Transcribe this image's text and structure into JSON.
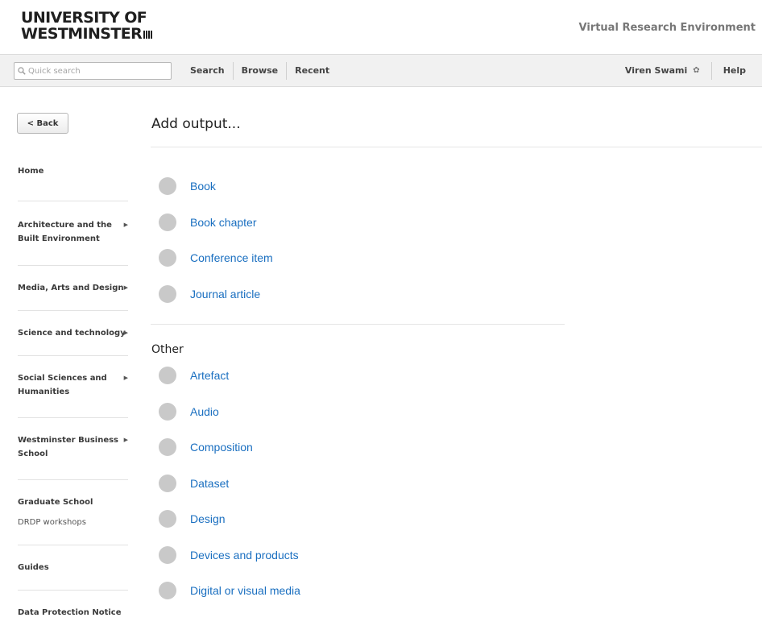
{
  "header": {
    "logo_line1": "UNIVERSITY OF",
    "logo_line2": "WESTMINSTER",
    "app_name": "Virtual Research Environment"
  },
  "navbar": {
    "search_placeholder": "Quick search",
    "links": [
      "Search",
      "Browse",
      "Recent"
    ],
    "user_name": "Viren Swami",
    "help_label": "Help"
  },
  "sidebar": {
    "back_label": "< Back",
    "items": [
      {
        "label": "Home",
        "arrow": ""
      },
      {
        "label": "Architecture and the Built Environment",
        "arrow": "▶"
      },
      {
        "label": "Media, Arts and Design",
        "arrow": "▶"
      },
      {
        "label": "Science and technology",
        "arrow": "▶"
      },
      {
        "label": "Social Sciences and Humanities",
        "arrow": "▶"
      },
      {
        "label": "Westminster Business School",
        "arrow": "▶"
      },
      {
        "label": "Graduate School",
        "sub": "DRDP workshops",
        "arrow": ""
      },
      {
        "label": "Guides",
        "arrow": ""
      },
      {
        "label": "Data Protection Notice",
        "arrow": ""
      }
    ]
  },
  "main": {
    "title": "Add output...",
    "primary_options": [
      "Book",
      "Book chapter",
      "Conference item",
      "Journal article"
    ],
    "other_heading": "Other",
    "other_options": [
      "Artefact",
      "Audio",
      "Composition",
      "Dataset",
      "Design",
      "Devices and products",
      "Digital or visual media"
    ]
  },
  "colors": {
    "link": "#1a6fc0",
    "radio": "#c9c9c9",
    "navbar_bg": "#f1f1f1"
  }
}
